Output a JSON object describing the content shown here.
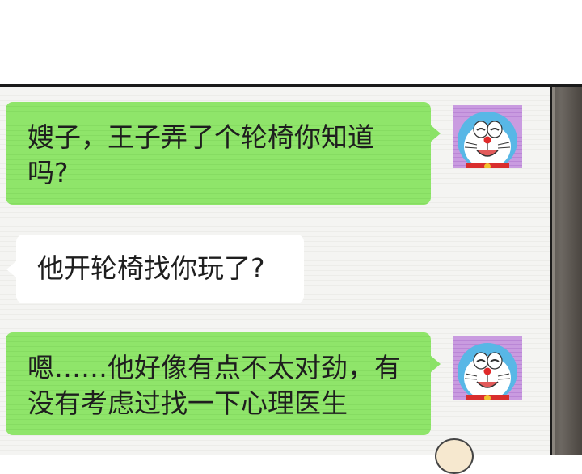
{
  "messages": [
    {
      "side": "right",
      "text": "嫂子，王子弄了个轮椅你知道吗?",
      "line1": "嫂子，王子弄了个轮椅你知道",
      "line2": "吗?"
    },
    {
      "side": "left",
      "text": "他开轮椅找你玩了?",
      "line1": "他开轮椅找你玩了?"
    },
    {
      "side": "right",
      "text": "嗯……他好像有点不太对劲，有没有考虑过找一下心理医生",
      "line1": "嗯……他好像有点不太对劲，有",
      "line2": "没有考虑过找一下心理医生"
    }
  ],
  "avatar": {
    "icon": "doraemon-avatar-icon",
    "background": "#c99be0"
  },
  "colors": {
    "sent_bubble": "#8fe56a",
    "received_bubble": "#ffffff",
    "chat_bg": "#f3f3f1"
  }
}
